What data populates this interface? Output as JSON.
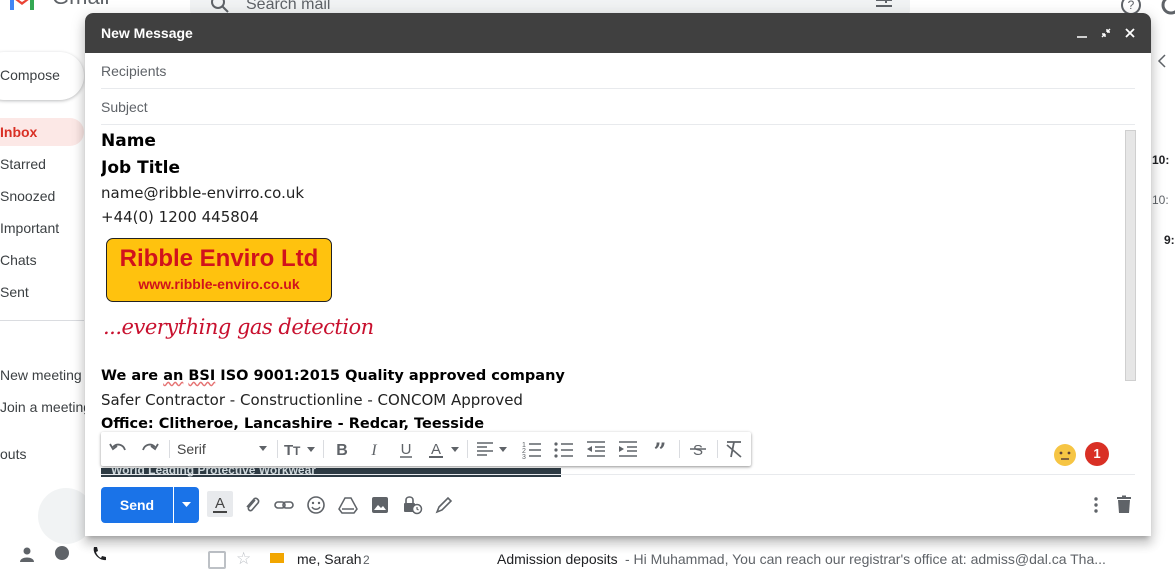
{
  "gmail": {
    "brand": "Gmail",
    "search_placeholder": "Search mail",
    "compose_label": "Compose",
    "nav": [
      "Inbox",
      "Starred",
      "Snoozed",
      "Important",
      "Chats",
      "Sent"
    ],
    "meet": [
      "New meeting",
      "Join a meeting"
    ],
    "hangouts_label": "outs",
    "right_times": [
      "10:",
      "10:",
      "9:"
    ],
    "background_row": {
      "sender": "me, Sarah",
      "count": "2",
      "subject": "Admission deposits",
      "snippet": " - Hi Muhammad, You can reach our registrar's office at: admiss@dal.ca Tha..."
    }
  },
  "compose": {
    "title": "New Message",
    "recipients_placeholder": "Recipients",
    "subject_placeholder": "Subject",
    "signature": {
      "name": "Name",
      "job_title": "Job Title",
      "email": "name@ribble-envirro.co.uk",
      "phone": "+44(0) 1200 445804",
      "logo_line1": "Ribble Enviro Ltd",
      "logo_line2": "www.ribble-enviro.co.uk",
      "tagline": "...everything gas detection",
      "iso_prefix": "We are ",
      "iso_an": "an",
      "iso_mid": " ",
      "iso_bsi": "BSI",
      "iso_suffix": " ISO 9001:2015 Quality approved company",
      "contractor": "Safer Contractor - Constructionline - CONCOM Approved",
      "office": "Office: Clitheroe, Lancashire - Redcar, Teesside",
      "banner_text": "World Leading Protective Workwear"
    },
    "toolbar": {
      "font": "Serif"
    },
    "badge_count": "1",
    "send_label": "Send"
  },
  "colors": {
    "send_blue": "#1a73e8",
    "titlebar": "#404040",
    "logo_yellow": "#ffc20e",
    "logo_red": "#d1121c",
    "badge_red": "#d93025"
  }
}
